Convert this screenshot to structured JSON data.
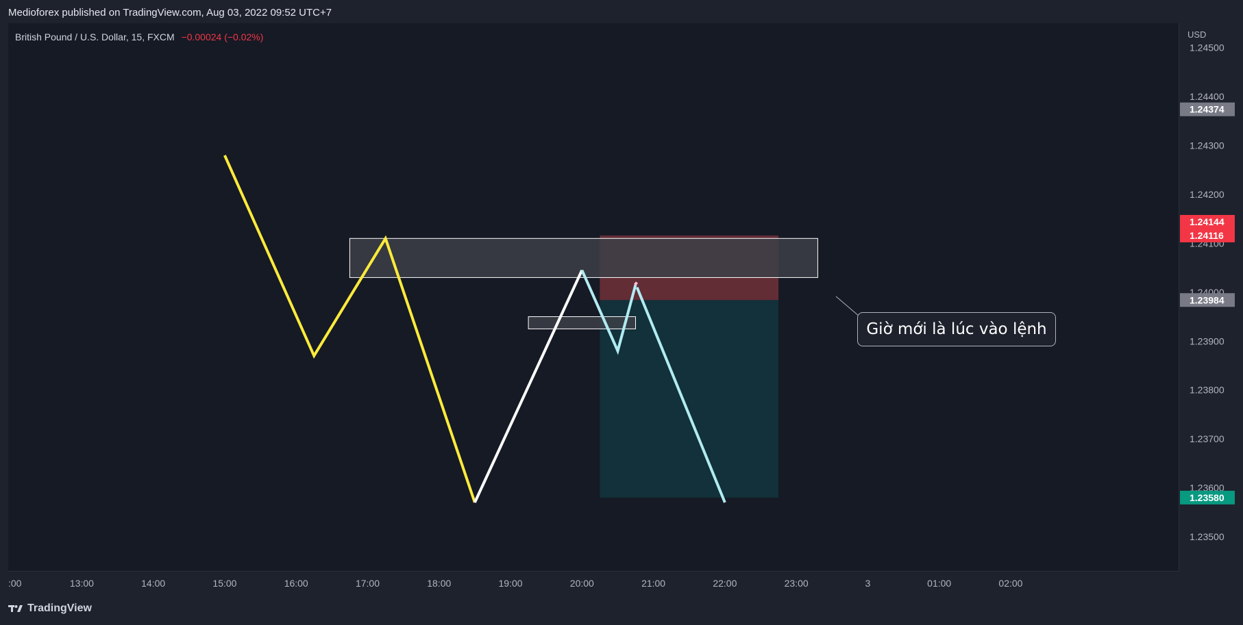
{
  "header": {
    "text": "Medioforex published on TradingView.com, Aug 03, 2022 09:52 UTC+7"
  },
  "symbol": {
    "name": "British Pound / U.S. Dollar, 15, FXCM",
    "change": "−0.00024 (−0.02%)"
  },
  "price_axis": {
    "currency": "USD"
  },
  "callout": {
    "text": "Giờ mới là lúc vào lệnh"
  },
  "footer": {
    "brand": "TradingView",
    "logo_icon": "tradingview-logo-icon"
  },
  "colors": {
    "background": "#161a25",
    "panel": "#1e222d",
    "yellow_path": "#ffeb3b",
    "white_path": "#ffffff",
    "post_entry_path": "#b2ebf2",
    "post_entry_stop_path": "#f8bbd0",
    "stop_zone": "#6b3038",
    "target_zone": "#12313a",
    "entry_badge": "#787b86",
    "stop_badge": "#f23645",
    "target_badge": "#089981",
    "box_fill": "#3c3f46"
  },
  "chart_data": {
    "type": "line",
    "title": "",
    "xlabel": "",
    "ylabel": "",
    "x_axis": {
      "ticks": [
        ":00",
        "13:00",
        "14:00",
        "15:00",
        "16:00",
        "17:00",
        "18:00",
        "19:00",
        "20:00",
        "21:00",
        "22:00",
        "23:00",
        "3",
        "01:00",
        "02:00"
      ],
      "tick_hours": [
        12,
        13,
        14,
        15,
        16,
        17,
        18,
        19,
        20,
        21,
        22,
        23,
        24,
        25,
        26
      ],
      "range_hours": [
        11.97,
        28.35
      ]
    },
    "y_axis": {
      "ticks": [
        "1.23500",
        "1.23600",
        "1.23700",
        "1.23800",
        "1.23900",
        "1.24000",
        "1.24100",
        "1.24200",
        "1.24300",
        "1.24400",
        "1.24500"
      ],
      "tick_values": [
        1.235,
        1.236,
        1.237,
        1.238,
        1.239,
        1.24,
        1.241,
        1.242,
        1.243,
        1.244,
        1.245
      ],
      "range": [
        1.2343,
        1.2455
      ]
    },
    "grid": false,
    "series": [
      {
        "color": "#ffeb3b",
        "points": [
          [
            15.0,
            1.2428
          ],
          [
            16.25,
            1.2387
          ],
          [
            17.25,
            1.2411
          ],
          [
            18.5,
            1.2357
          ]
        ]
      },
      {
        "color": "#ffffff",
        "points": [
          [
            18.5,
            1.2357
          ],
          [
            20.0,
            1.24045
          ]
        ]
      },
      {
        "color": "#b2ebf2",
        "points": [
          [
            20.0,
            1.24045
          ],
          [
            20.5,
            1.2388
          ],
          [
            20.75,
            1.24015
          ]
        ]
      },
      {
        "color": "#f8bbd0",
        "points": [
          [
            20.74,
            1.24015
          ],
          [
            20.77,
            1.2402
          ]
        ]
      },
      {
        "color": "#b2ebf2",
        "points": [
          [
            20.77,
            1.2401
          ],
          [
            22.0,
            1.2357
          ]
        ]
      }
    ],
    "zones": [
      {
        "kind": "resistance-box",
        "x": [
          16.75,
          23.3
        ],
        "y": [
          1.2403,
          1.2411
        ]
      },
      {
        "kind": "small-box",
        "x": [
          19.25,
          20.75
        ],
        "y": [
          1.23925,
          1.2395
        ]
      },
      {
        "kind": "stop-zone",
        "x": [
          20.25,
          22.75
        ],
        "y": [
          1.23984,
          1.24116
        ]
      },
      {
        "kind": "target-zone",
        "x": [
          20.25,
          22.75
        ],
        "y": [
          1.2358,
          1.23984
        ]
      }
    ],
    "price_badges": [
      {
        "label": "1.24374",
        "value": 1.24374,
        "color": "#787b86"
      },
      {
        "label": "1.24144",
        "value": 1.24144,
        "color": "#f23645"
      },
      {
        "label": "1.24116",
        "value": 1.24116,
        "color": "#f23645"
      },
      {
        "label": "1.23984",
        "value": 1.23984,
        "color": "#787b86"
      },
      {
        "label": "1.23580",
        "value": 1.2358,
        "color": "#089981"
      }
    ]
  }
}
